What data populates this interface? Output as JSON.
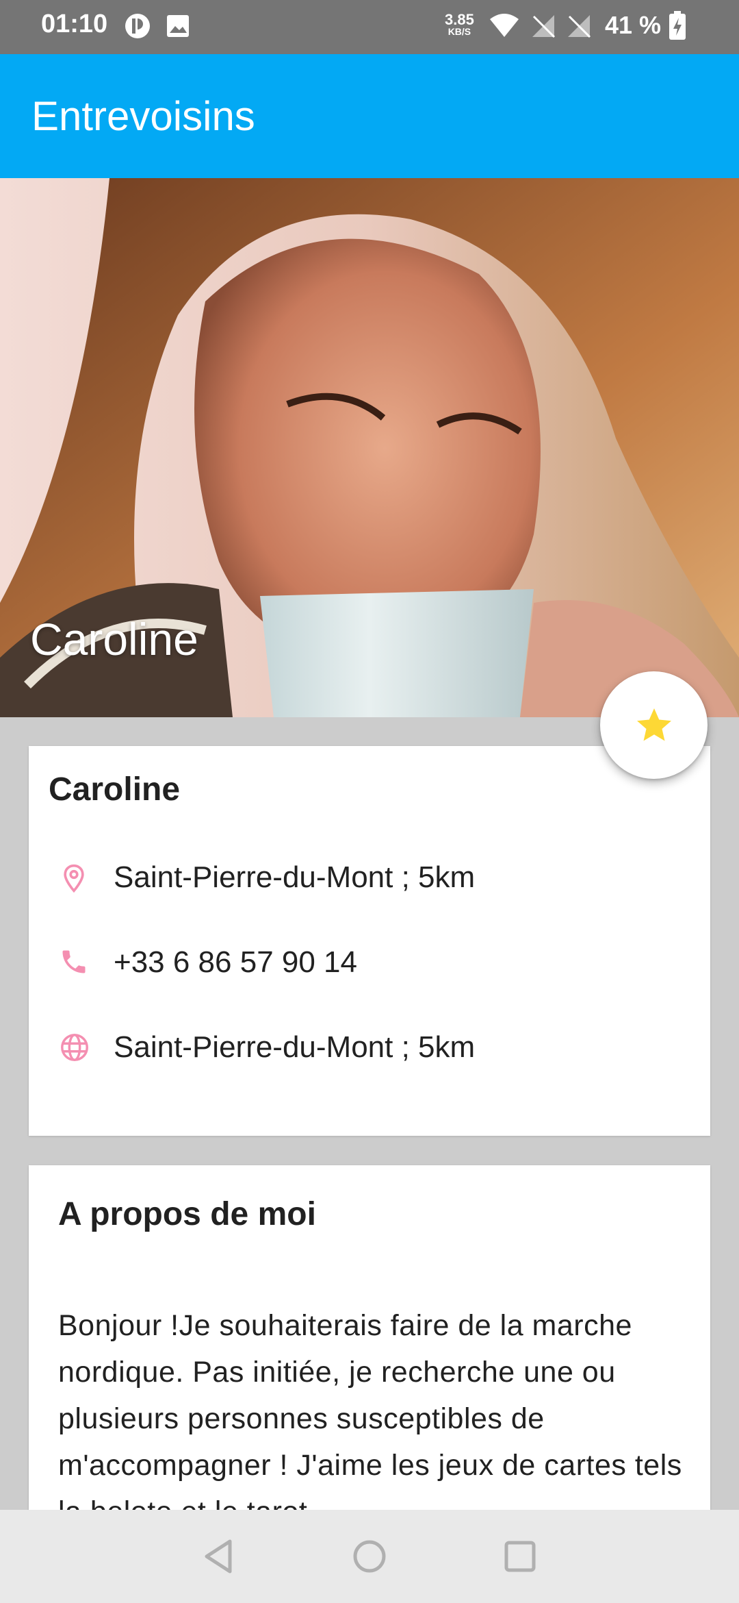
{
  "status_bar": {
    "time": "01:10",
    "net_speed": "3.85",
    "net_speed_unit": "KB/S",
    "battery": "41 %"
  },
  "app_bar": {
    "title": "Entrevoisins"
  },
  "header": {
    "name": "Caroline"
  },
  "fab": {
    "icon": "star-icon",
    "color": "#fdd835"
  },
  "profile": {
    "name": "Caroline",
    "location": "Saint-Pierre-du-Mont ; 5km",
    "phone": "+33 6 86 57 90 14",
    "web": "Saint-Pierre-du-Mont ; 5km",
    "icon_color": "#f48fb1"
  },
  "about": {
    "title": "A propos de moi",
    "text": "Bonjour !Je souhaiterais faire de la marche nordique. Pas initiée, je recherche une ou plusieurs personnes susceptibles de m'accompagner ! J'aime les jeux de cartes tels la belote et le tarot.."
  },
  "colors": {
    "app_bar": "#03a9f4",
    "status_bar": "#757575",
    "background": "#cccccc"
  }
}
